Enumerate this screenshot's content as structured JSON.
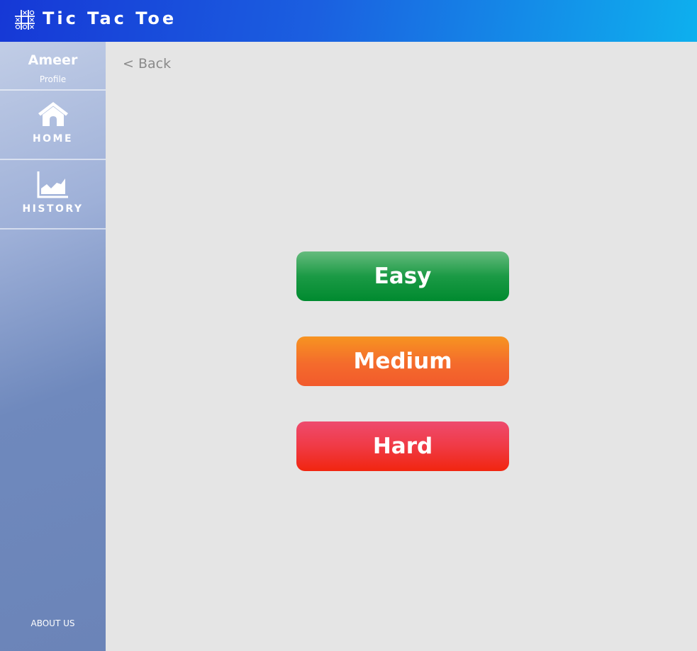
{
  "header": {
    "title": "Tic Tac Toe",
    "logo_icon": "tic-tac-toe-grid-icon"
  },
  "sidebar": {
    "profile": {
      "name": "Ameer",
      "label": "Profile"
    },
    "items": [
      {
        "label": "HOME",
        "icon": "home-icon"
      },
      {
        "label": "HISTORY",
        "icon": "history-chart-icon"
      }
    ],
    "about_label": "ABOUT US"
  },
  "main": {
    "back_label": "< Back",
    "difficulty_buttons": [
      {
        "label": "Easy",
        "color": "#008a2f"
      },
      {
        "label": "Medium",
        "color": "#f46b2c"
      },
      {
        "label": "Hard",
        "color": "#f1250f"
      }
    ]
  },
  "colors": {
    "header_start": "#1638d6",
    "header_end": "#0eb0ee",
    "sidebar": "#6b84b8",
    "background": "#e5e5e5"
  }
}
